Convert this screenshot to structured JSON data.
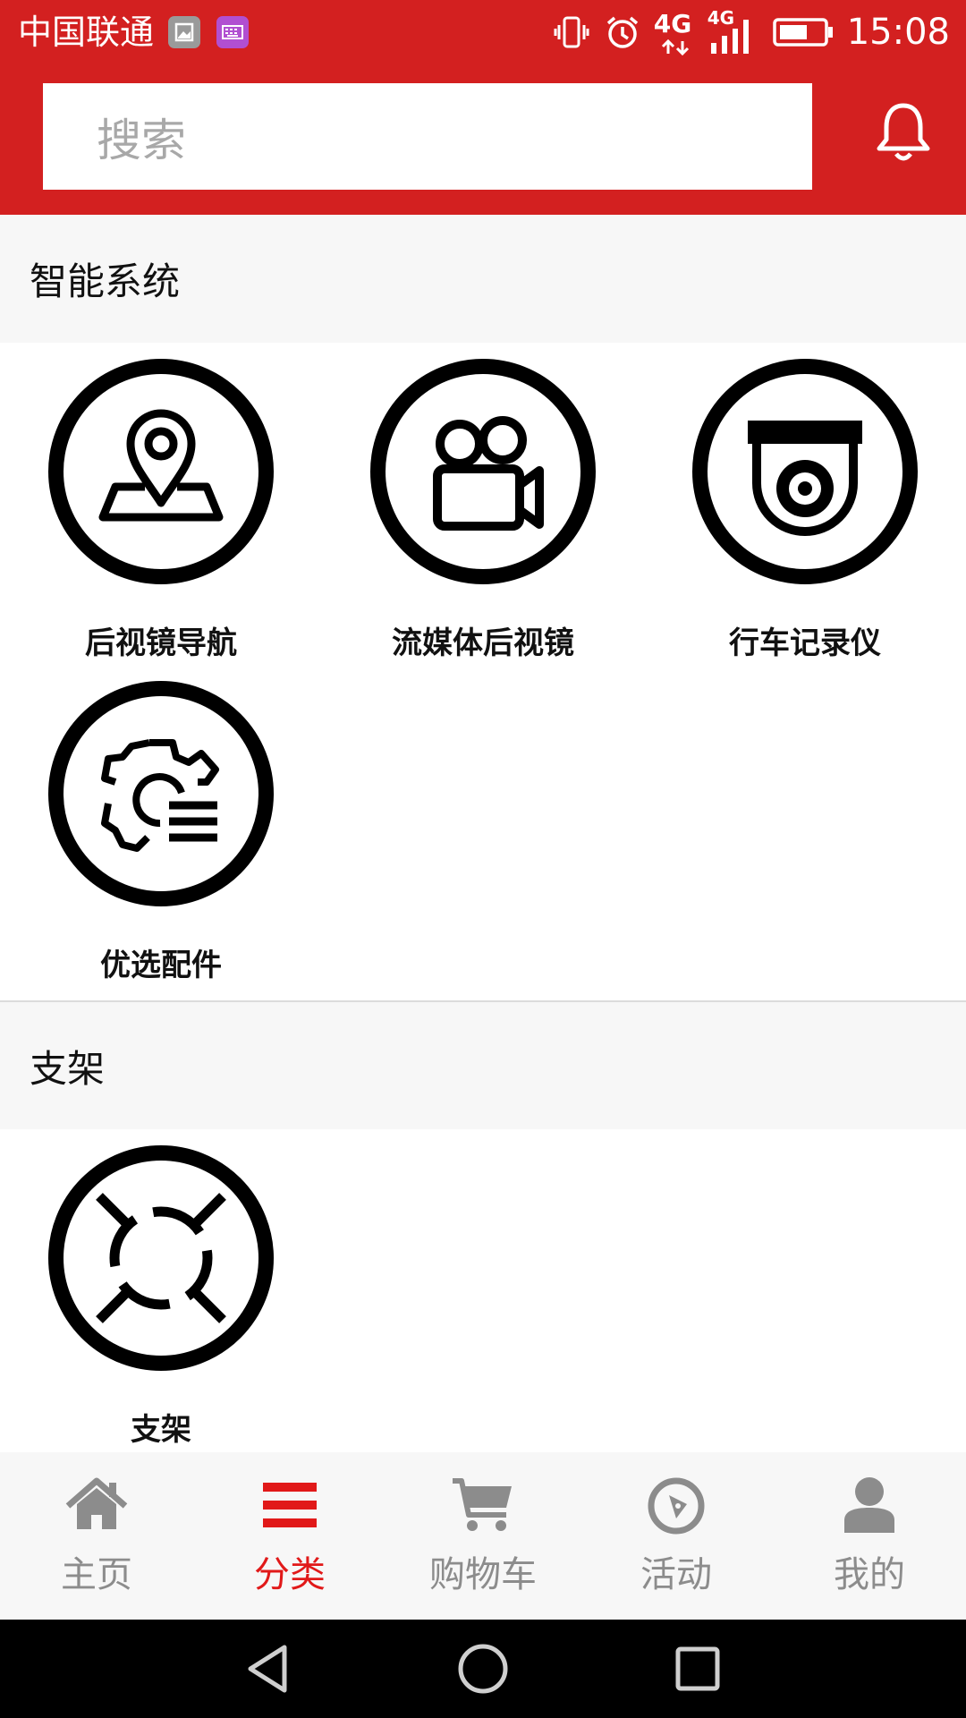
{
  "status_bar": {
    "carrier": "中国联通",
    "network_1": "4G",
    "network_2": "4G",
    "time": "15:08"
  },
  "search": {
    "placeholder": "搜索"
  },
  "sections": [
    {
      "title": "智能系统",
      "items": [
        {
          "label": "后视镜导航",
          "icon": "map-pin-icon"
        },
        {
          "label": "流媒体后视镜",
          "icon": "video-camera-icon"
        },
        {
          "label": "行车记录仪",
          "icon": "dashcam-icon"
        },
        {
          "label": "优选配件",
          "icon": "gear-list-icon"
        }
      ]
    },
    {
      "title": "支架",
      "items": [
        {
          "label": "支架",
          "icon": "lifebuoy-icon"
        }
      ]
    }
  ],
  "tab_bar": {
    "active": "分类",
    "active_color": "#e11919",
    "inactive_color": "#8c8c8c",
    "items": [
      {
        "label": "主页",
        "icon": "home-icon"
      },
      {
        "label": "分类",
        "icon": "menu-icon"
      },
      {
        "label": "购物车",
        "icon": "cart-icon"
      },
      {
        "label": "活动",
        "icon": "compass-icon"
      },
      {
        "label": "我的",
        "icon": "user-icon"
      }
    ]
  },
  "colors": {
    "header": "#d32020",
    "background": "#ffffff",
    "section_header": "#f7f7f7"
  }
}
